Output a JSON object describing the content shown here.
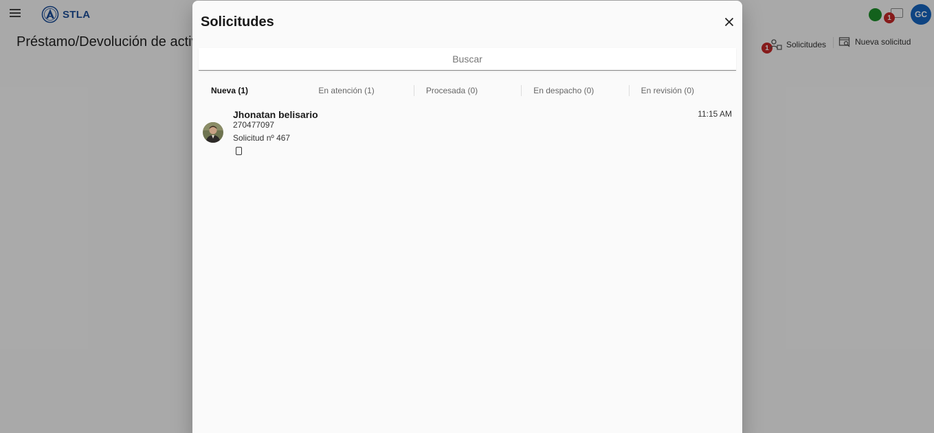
{
  "app": {
    "logo_text": "STLA",
    "page_title": "Préstamo/Devolución de activos",
    "notification_count": "1",
    "user_initials": "GC",
    "colors": {
      "brand": "#1d4f9a",
      "status_online": "#1d8f2a",
      "badge": "#c62828",
      "avatar": "#1565c0"
    },
    "actions": {
      "solicitudes_label": "Solicitudes",
      "solicitudes_badge": "1",
      "nueva_label": "Nueva solicitud"
    }
  },
  "dialog": {
    "title": "Solicitudes",
    "search_placeholder": "Buscar",
    "tabs": [
      {
        "label": "Nueva (1)",
        "active": true
      },
      {
        "label": "En atención (1)",
        "active": false
      },
      {
        "label": "Procesada (0)",
        "active": false
      },
      {
        "label": "En despacho (0)",
        "active": false
      },
      {
        "label": "En revisión (0)",
        "active": false
      }
    ],
    "requests": [
      {
        "name": "Jhonatan belisario",
        "phone": "270477097",
        "number": "Solicitud nº 467",
        "time": "11:15 AM",
        "device_icon": "smartphone-icon"
      }
    ]
  }
}
